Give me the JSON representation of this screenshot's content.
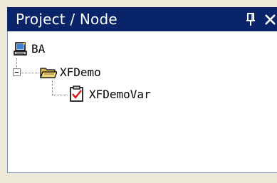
{
  "panel": {
    "title": "Project / Node",
    "pin_icon": "pin-icon",
    "close_icon": "close-icon"
  },
  "tree": {
    "nodes": [
      {
        "label": "BA",
        "icon": "workstation-icon",
        "level": 0
      },
      {
        "label": "XFDemo",
        "icon": "folder-open-icon",
        "level": 1,
        "expanded": true
      },
      {
        "label": "XFDemoVar",
        "icon": "checklist-icon",
        "level": 2
      }
    ]
  },
  "colors": {
    "titlebar": "#0a246a",
    "titletext": "#ffffff",
    "tree_background": "#ffffff",
    "panel_background": "#ece9d8"
  }
}
